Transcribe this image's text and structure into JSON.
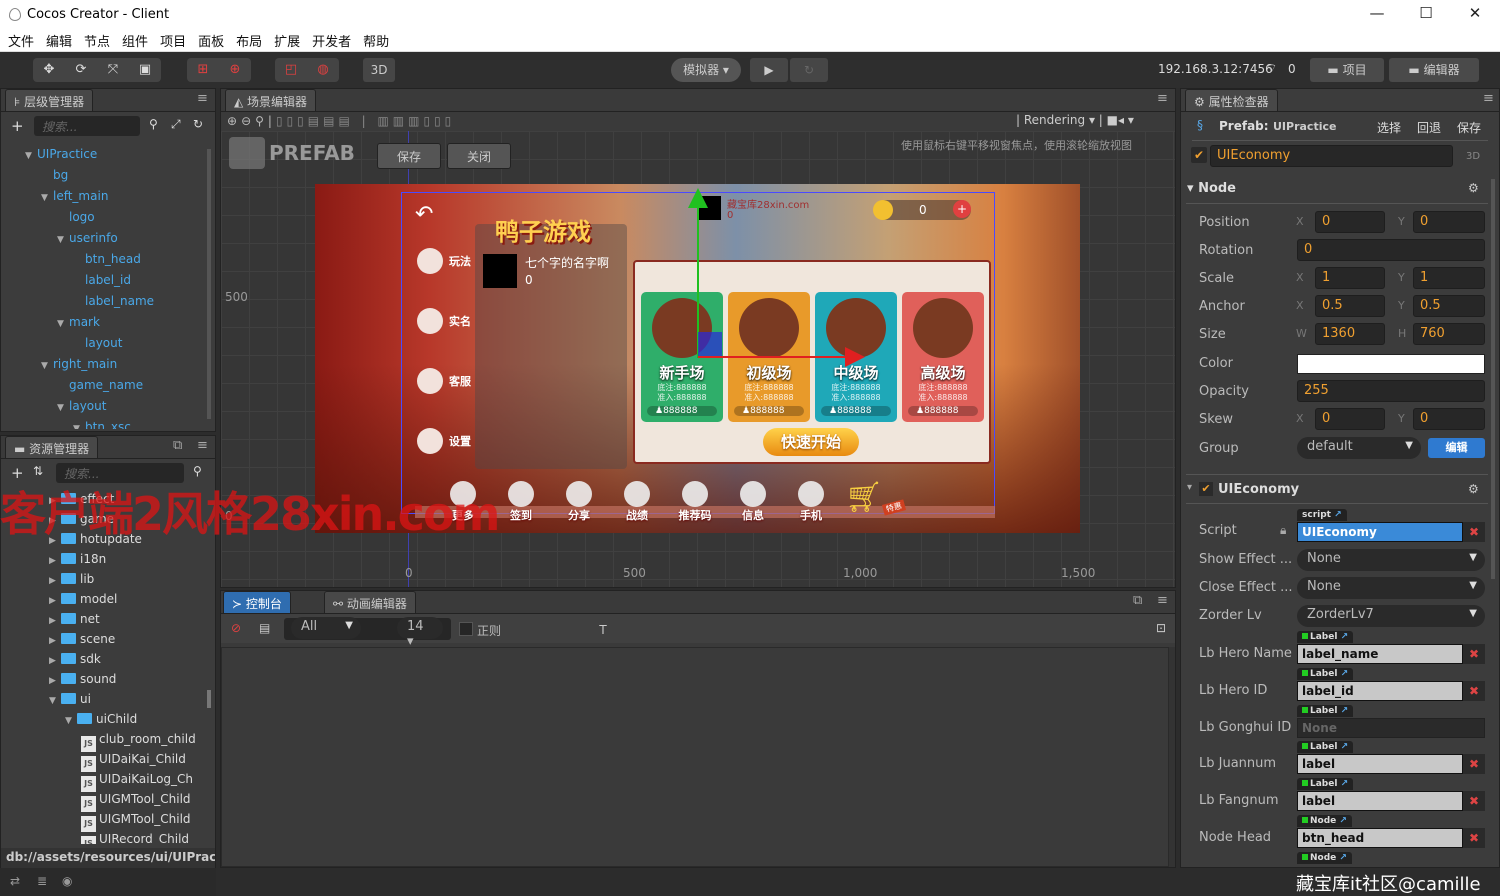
{
  "window": {
    "title": "Cocos Creator - Client",
    "minimize": "—",
    "maximize": "☐",
    "close": "✕"
  },
  "menu": [
    "文件",
    "编辑",
    "节点",
    "组件",
    "项目",
    "面板",
    "布局",
    "扩展",
    "开发者",
    "帮助"
  ],
  "toolbar": {
    "transform_tools": [
      "✥",
      "⟳",
      "⤧",
      "▣"
    ],
    "pivot_tools": [
      "⊞",
      "⊕"
    ],
    "snap_tools": [
      "◰",
      "◍"
    ],
    "mode_3d": "3D",
    "simulator": "模拟器 ▾",
    "play": "▶",
    "refresh": "↻",
    "ip": "192.168.3.12:7456",
    "wifi_count": "0",
    "project_btn": "项目",
    "editor_btn": "编辑器"
  },
  "hierarchy": {
    "title": "层级管理器",
    "search_placeholder": "搜索...",
    "nodes": [
      {
        "label": "UIPractice",
        "depth": 0,
        "expanded": true
      },
      {
        "label": "bg",
        "depth": 1
      },
      {
        "label": "left_main",
        "depth": 1,
        "expanded": true
      },
      {
        "label": "logo",
        "depth": 2
      },
      {
        "label": "userinfo",
        "depth": 2,
        "expanded": true
      },
      {
        "label": "btn_head",
        "depth": 3
      },
      {
        "label": "label_id",
        "depth": 3
      },
      {
        "label": "label_name",
        "depth": 3
      },
      {
        "label": "mark",
        "depth": 2,
        "expanded": true
      },
      {
        "label": "layout",
        "depth": 3
      },
      {
        "label": "right_main",
        "depth": 1,
        "expanded": true
      },
      {
        "label": "game_name",
        "depth": 2
      },
      {
        "label": "layout",
        "depth": 2,
        "expanded": true
      },
      {
        "label": "btn_xsc",
        "depth": 3,
        "expanded": true
      }
    ]
  },
  "assets": {
    "title": "资源管理器",
    "search_placeholder": "搜索...",
    "items": [
      {
        "label": "effect",
        "type": "folder",
        "depth": 0
      },
      {
        "label": "game",
        "type": "folder",
        "depth": 0
      },
      {
        "label": "hotupdate",
        "type": "folder",
        "depth": 0
      },
      {
        "label": "i18n",
        "type": "folder",
        "depth": 0
      },
      {
        "label": "lib",
        "type": "folder",
        "depth": 0
      },
      {
        "label": "model",
        "type": "folder",
        "depth": 0
      },
      {
        "label": "net",
        "type": "folder",
        "depth": 0
      },
      {
        "label": "scene",
        "type": "folder",
        "depth": 0
      },
      {
        "label": "sdk",
        "type": "folder",
        "depth": 0
      },
      {
        "label": "sound",
        "type": "folder",
        "depth": 0
      },
      {
        "label": "ui",
        "type": "folder",
        "depth": 0,
        "expanded": true
      },
      {
        "label": "uiChild",
        "type": "folder",
        "depth": 1,
        "expanded": true
      },
      {
        "label": "club_room_child",
        "type": "js",
        "depth": 2
      },
      {
        "label": "UIDaiKai_Child",
        "type": "js",
        "depth": 2
      },
      {
        "label": "UIDaiKaiLog_Ch",
        "type": "js",
        "depth": 2
      },
      {
        "label": "UIGMTool_Child",
        "type": "js",
        "depth": 2
      },
      {
        "label": "UIGMTool_Child",
        "type": "js",
        "depth": 2
      },
      {
        "label": "UIRecord_Child",
        "type": "js",
        "depth": 2
      }
    ],
    "path": "db://assets/resources/ui/UIPract..."
  },
  "scene": {
    "title": "场景编辑器",
    "rendering": "Rendering",
    "prefab_label": "PREFAB",
    "save": "保存",
    "close": "关闭",
    "hint": "使用鼠标右键平移视窗焦点，使用滚轮缩放视图",
    "y_ticks": [
      "500",
      "0"
    ],
    "x_ticks": [
      "0",
      "500",
      "1,000",
      "1,500"
    ],
    "game": {
      "title": "鸭子游戏",
      "player_name": "七个字的名字啊",
      "player_score": "0",
      "top_name": "藏宝库28xin.com",
      "top_score": "0",
      "coins": "0",
      "side": [
        "玩法",
        "实名",
        "客服",
        "设置"
      ],
      "rooms": [
        {
          "name": "新手场",
          "base": "底注:888888",
          "entry": "准入:888888",
          "players": "888888",
          "color": "#2fae6a"
        },
        {
          "name": "初级场",
          "base": "底注:888888",
          "entry": "准入:888888",
          "players": "888888",
          "color": "#e89a2a"
        },
        {
          "name": "中级场",
          "base": "底注:888888",
          "entry": "准入:888888",
          "players": "888888",
          "color": "#1fa8b8"
        },
        {
          "name": "高级场",
          "base": "底注:888888",
          "entry": "准入:888888",
          "players": "888888",
          "color": "#e0605a"
        }
      ],
      "quick_start": "快速开始",
      "bottom": [
        "更多",
        "签到",
        "分享",
        "战绩",
        "推荐码",
        "信息",
        "手机"
      ],
      "shop_badge": "特惠"
    }
  },
  "console": {
    "tab_console": "控制台",
    "tab_animation": "动画编辑器",
    "regex": "正则",
    "level": "All",
    "font_size": "14"
  },
  "inspector": {
    "title": "属性检查器",
    "prefab_label": "Prefab:",
    "prefab_name": "UIPractice",
    "select": "选择",
    "revert": "回退",
    "save": "保存",
    "node_name": "UIEconomy",
    "mode": "3D",
    "node_section": "Node",
    "position": {
      "label": "Position",
      "x": "0",
      "y": "0"
    },
    "rotation": {
      "label": "Rotation",
      "value": "0"
    },
    "scale": {
      "label": "Scale",
      "x": "1",
      "y": "1"
    },
    "anchor": {
      "label": "Anchor",
      "x": "0.5",
      "y": "0.5"
    },
    "size": {
      "label": "Size",
      "w": "1360",
      "h": "760"
    },
    "color": {
      "label": "Color",
      "value": "#ffffff"
    },
    "opacity": {
      "label": "Opacity",
      "value": "255"
    },
    "skew": {
      "label": "Skew",
      "x": "0",
      "y": "0"
    },
    "group": {
      "label": "Group",
      "value": "default",
      "edit": "编辑"
    },
    "component": "UIEconomy",
    "script": {
      "label": "Script",
      "tag": "script",
      "value": "UIEconomy"
    },
    "show_effect": {
      "label": "Show Effect ...",
      "value": "None"
    },
    "close_effect": {
      "label": "Close Effect ...",
      "value": "None"
    },
    "zorder": {
      "label": "Zorder Lv",
      "value": "ZorderLv7"
    },
    "refs": [
      {
        "label": "Lb Hero Name",
        "tag": "Label",
        "value": "label_name"
      },
      {
        "label": "Lb Hero ID",
        "tag": "Label",
        "value": "label_id"
      },
      {
        "label": "Lb Gonghui ID",
        "tag": "Label",
        "value": "None",
        "empty": true
      },
      {
        "label": "Lb Juannum",
        "tag": "Label",
        "value": "label"
      },
      {
        "label": "Lb Fangnum",
        "tag": "Label",
        "value": "label"
      },
      {
        "label": "Node Head",
        "tag": "Node",
        "value": "btn_head"
      },
      {
        "label": "",
        "tag": "Node",
        "value": "",
        "partial": true
      }
    ]
  },
  "watermark": {
    "overlay": "客户端2风格28xin.com",
    "corner": "藏宝库it社区@camille",
    "tile": "藏宝库\n28xin.com"
  }
}
